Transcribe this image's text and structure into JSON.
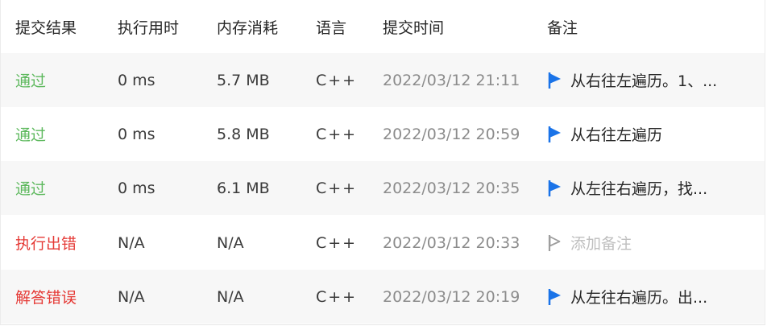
{
  "headers": {
    "status": "提交结果",
    "runtime": "执行用时",
    "memory": "内存消耗",
    "language": "语言",
    "submitted": "提交时间",
    "note": "备注"
  },
  "colors": {
    "pass": "#5cb85c",
    "error": "#e53935",
    "flag_active": "#1a73e8",
    "flag_inactive": "#9e9e9e"
  },
  "rows": [
    {
      "status": "通过",
      "runtime": "0 ms",
      "memory": "5.7 MB",
      "language": "C++",
      "submitted": "2022/03/12 21:11",
      "note": "从右往左遍历。1、..."
    },
    {
      "status": "通过",
      "runtime": "0 ms",
      "memory": "5.8 MB",
      "language": "C++",
      "submitted": "2022/03/12 20:59",
      "note": "从右往左遍历"
    },
    {
      "status": "通过",
      "runtime": "0 ms",
      "memory": "6.1 MB",
      "language": "C++",
      "submitted": "2022/03/12 20:35",
      "note": "从左往右遍历，找..."
    },
    {
      "status": "执行出错",
      "runtime": "N/A",
      "memory": "N/A",
      "language": "C++",
      "submitted": "2022/03/12 20:33",
      "note": "添加备注"
    },
    {
      "status": "解答错误",
      "runtime": "N/A",
      "memory": "N/A",
      "language": "C++",
      "submitted": "2022/03/12 20:19",
      "note": "从左往右遍历。出..."
    }
  ]
}
